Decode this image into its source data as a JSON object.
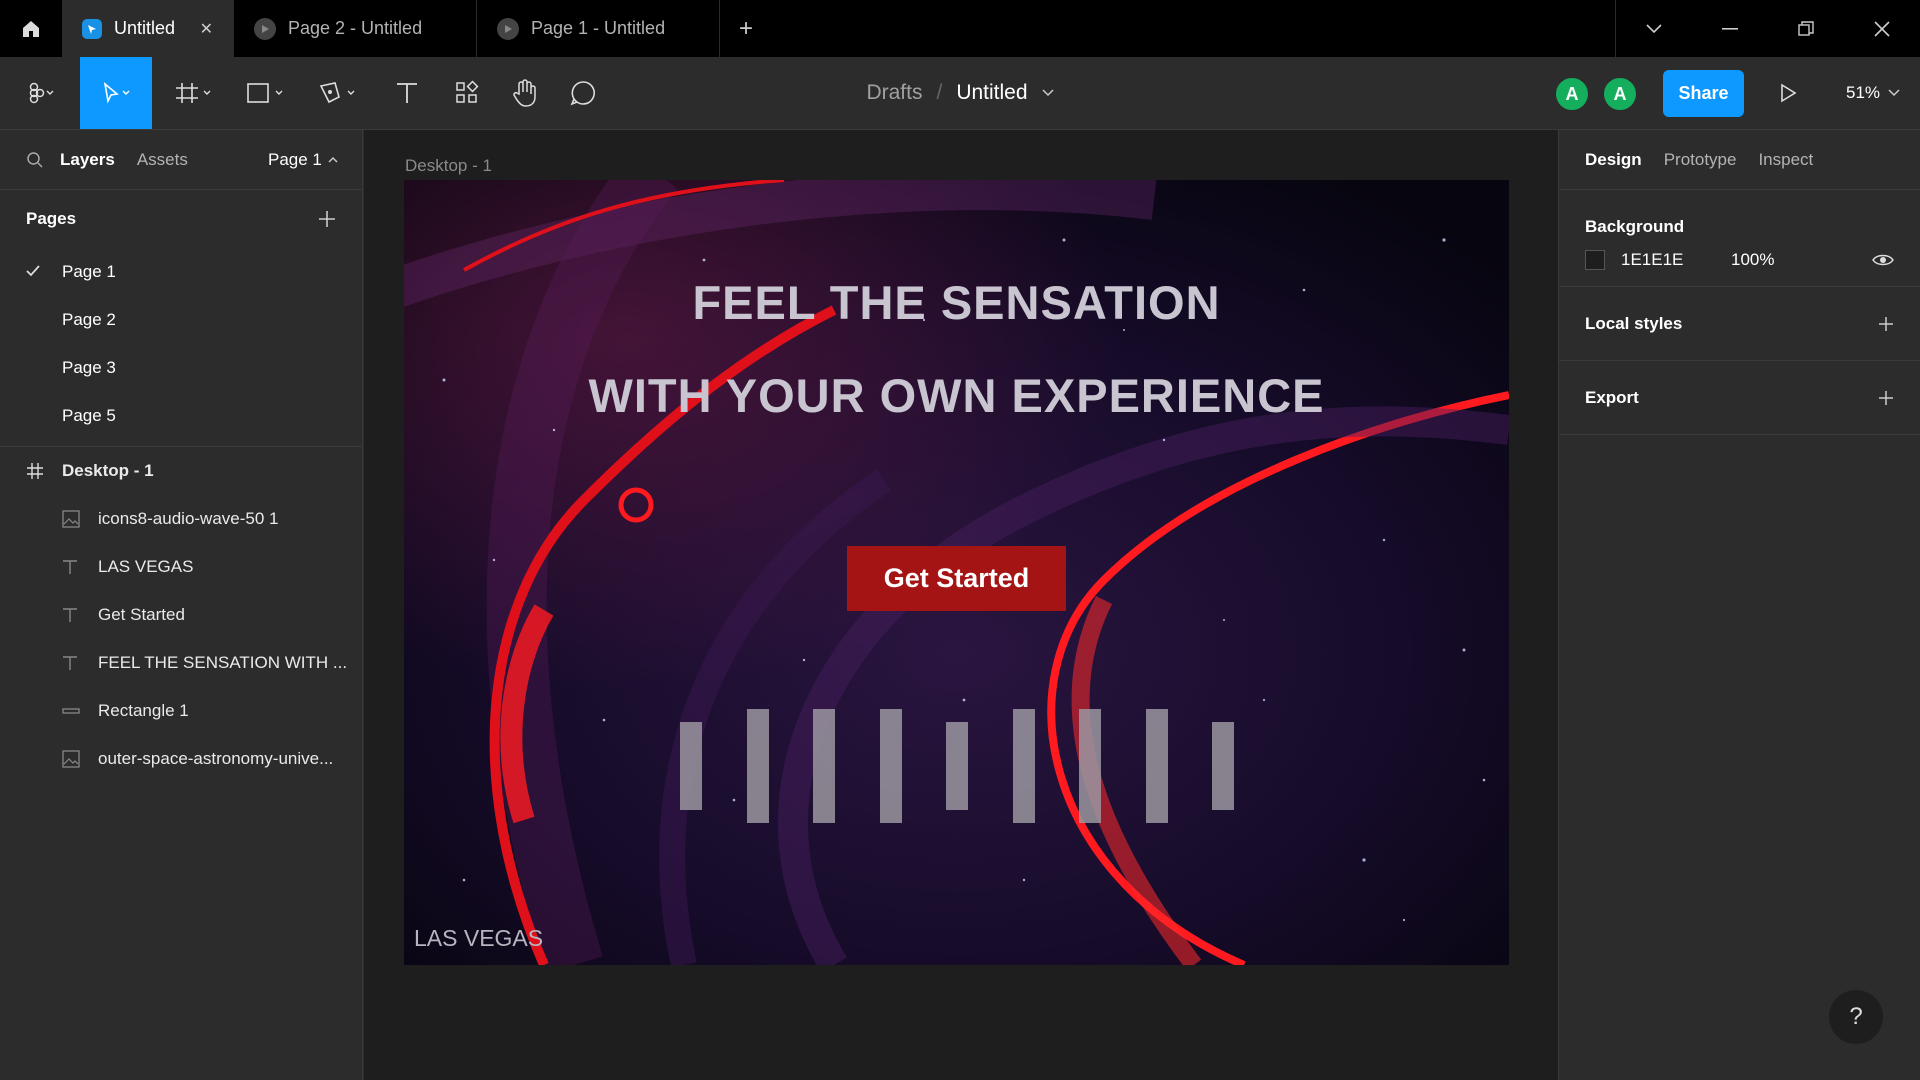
{
  "titlebar": {
    "tabs": [
      {
        "label": "Untitled",
        "close": "✕"
      },
      {
        "label": "Page 2 - Untitled"
      },
      {
        "label": "Page 1 - Untitled"
      }
    ],
    "new_tab": "+"
  },
  "toolbar": {
    "breadcrumb_drafts": "Drafts",
    "breadcrumb_sep": "/",
    "file_name": "Untitled",
    "avatars": [
      "A",
      "A"
    ],
    "share_label": "Share",
    "zoom": "51%"
  },
  "left_panel": {
    "tab_layers": "Layers",
    "tab_assets": "Assets",
    "page_selector": "Page 1",
    "pages_title": "Pages",
    "pages": [
      {
        "label": "Page 1",
        "current": true
      },
      {
        "label": "Page 2"
      },
      {
        "label": "Page 3"
      },
      {
        "label": "Page 5"
      }
    ],
    "frame_layer": "Desktop - 1",
    "layers": [
      {
        "label": "icons8-audio-wave-50 1",
        "icon": "image-icon"
      },
      {
        "label": "LAS VEGAS",
        "icon": "text-icon"
      },
      {
        "label": "Get Started",
        "icon": "text-icon"
      },
      {
        "label": "FEEL THE SENSATION WITH ...",
        "icon": "text-icon"
      },
      {
        "label": "Rectangle 1",
        "icon": "rectangle-icon"
      },
      {
        "label": "outer-space-astronomy-unive...",
        "icon": "image-icon"
      }
    ]
  },
  "canvas": {
    "frame_label": "Desktop - 1",
    "headline_1": "FEEL THE  SENSATION",
    "headline_2": "WITH YOUR OWN EXPERIENCE",
    "cta": "Get Started",
    "location": "LAS VEGAS"
  },
  "right_panel": {
    "tab_design": "Design",
    "tab_prototype": "Prototype",
    "tab_inspect": "Inspect",
    "background_title": "Background",
    "background_hex": "1E1E1E",
    "background_opacity": "100%",
    "local_styles": "Local styles",
    "export": "Export"
  },
  "help": "?",
  "colors": {
    "accent": "#0d99ff",
    "avatar": "#14ae5c",
    "cta": "#a51414",
    "background": "#1e1e1e"
  }
}
